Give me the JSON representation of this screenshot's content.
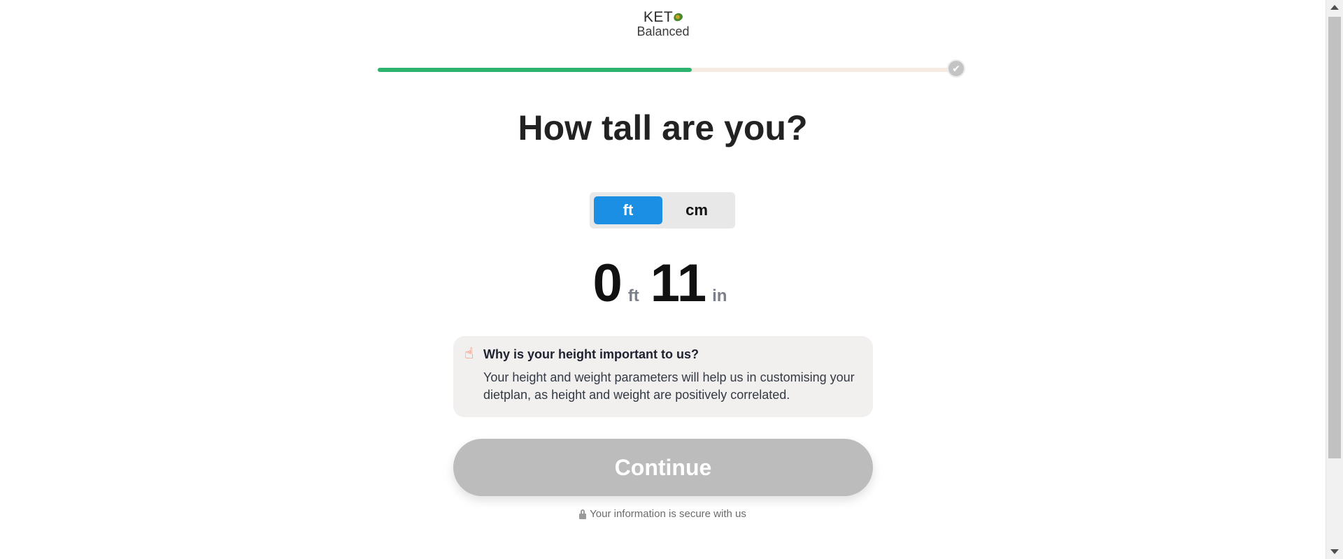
{
  "logo": {
    "line1": "KET",
    "line2": "Balanced"
  },
  "progress": {
    "fraction": 0.5436,
    "end_icon": "check-icon",
    "end_glyph": "✔",
    "colors": {
      "fill": "#2db36d",
      "track": "#f6ebe2"
    }
  },
  "question": {
    "title": "How tall are you?"
  },
  "unit_toggle": {
    "options": [
      "ft",
      "cm"
    ],
    "selected": "ft",
    "active_color": "#1a8fe3"
  },
  "height": {
    "feet": "0",
    "feet_unit": "ft",
    "inches": "11",
    "inches_unit": "in"
  },
  "info_card": {
    "icon": "pointing-finger-icon",
    "icon_glyph": "☝",
    "title": "Why is your height important to us?",
    "text": "Your height and weight parameters will help us in customising your dietplan, as height and weight are positively correlated."
  },
  "continue_button": {
    "label": "Continue"
  },
  "secure_note": {
    "icon": "lock-icon",
    "text": "Your information is secure with us"
  }
}
